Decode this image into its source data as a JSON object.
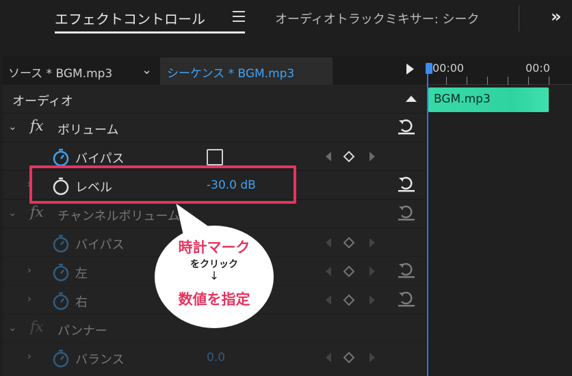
{
  "tabs": {
    "effect_controls": "エフェクトコントロール",
    "audio_track_mixer": "オーディオトラックミキサー: シーク"
  },
  "source_bar": {
    "source_label": "ソース * BGM.mp3",
    "sequence_label": "シーケンス * BGM.mp3"
  },
  "section": {
    "title": "オーディオ"
  },
  "effects": {
    "volume": {
      "name": "ボリューム",
      "bypass_label": "バイパス",
      "level_label": "レベル",
      "level_value": "-30.0 dB"
    },
    "channel_volume": {
      "name": "チャンネルボリューム",
      "bypass_label": "バイパス",
      "left_label": "左",
      "right_label": "右"
    },
    "panner": {
      "name": "パンナー",
      "balance_label": "バランス",
      "balance_value": "0.0"
    }
  },
  "timeline": {
    "time_start": "00:00",
    "time_next": "00:0",
    "clip_name": "BGM.mp3"
  },
  "callout": {
    "line1": "時計マーク",
    "line2": "をクリック",
    "line3": "↓",
    "line4": "数値を指定"
  },
  "colors": {
    "accent_blue": "#3fa3f5",
    "highlight_pink": "#e8335f",
    "clip_green": "#39d9a7"
  }
}
